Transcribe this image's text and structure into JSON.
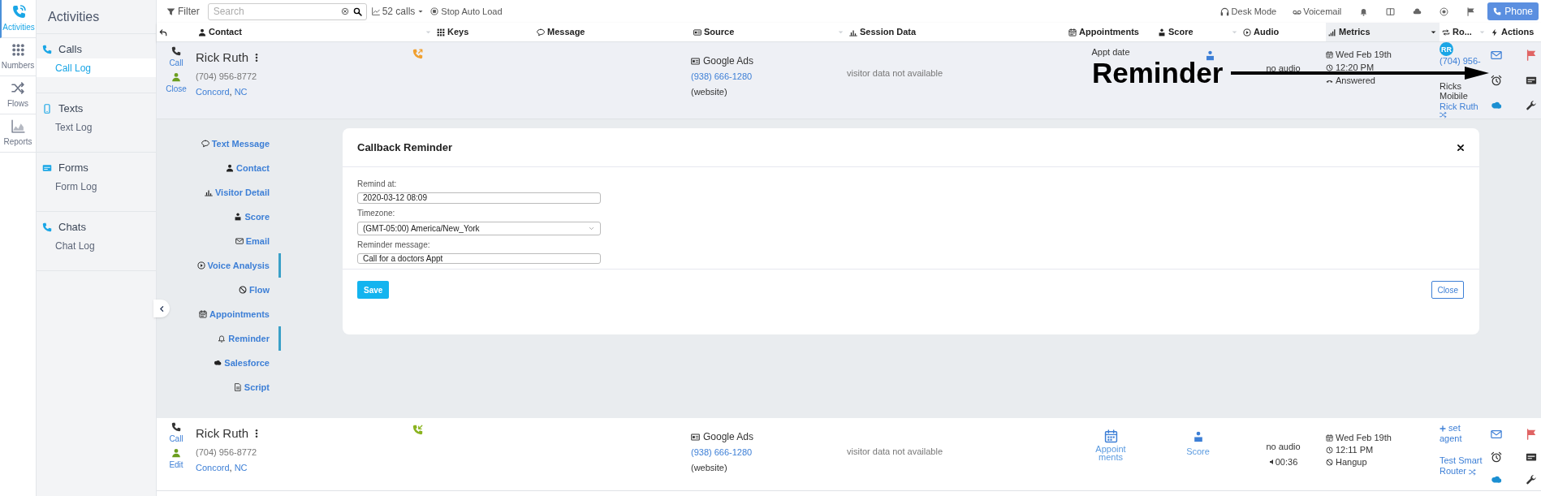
{
  "rail": [
    {
      "label": "Activities",
      "kind": "calls",
      "selected": true
    },
    {
      "label": "Numbers",
      "kind": "numbers",
      "selected": false
    },
    {
      "label": "Flows",
      "kind": "flows",
      "selected": false
    },
    {
      "label": "Reports",
      "kind": "reports",
      "selected": false
    }
  ],
  "panel": {
    "title": "Activities",
    "groups": [
      {
        "label": "Calls",
        "kind": "phone",
        "items": [
          {
            "label": "Call Log",
            "selected": true
          }
        ]
      },
      {
        "label": "Texts",
        "kind": "mobile",
        "items": [
          {
            "label": "Text Log",
            "selected": false
          }
        ]
      },
      {
        "label": "Forms",
        "kind": "card",
        "items": [
          {
            "label": "Form Log",
            "selected": false
          }
        ]
      },
      {
        "label": "Chats",
        "kind": "phone",
        "items": [
          {
            "label": "Chat Log",
            "selected": false
          }
        ]
      }
    ]
  },
  "toolbar": {
    "filter": "Filter",
    "search_placeholder": "Search",
    "count": "52 calls",
    "auto_load": "Stop Auto Load",
    "desk_mode": "Desk Mode",
    "voicemail": "Voicemail",
    "phone_button": "Phone"
  },
  "columns": [
    {
      "kind": "back",
      "sorted": false
    },
    {
      "label": "Contact",
      "kind": "contact",
      "dropdown": true,
      "sorted": false
    },
    {
      "label": "Keys",
      "kind": "keys",
      "sorted": false
    },
    {
      "label": "Message",
      "kind": "message",
      "sorted": false
    },
    {
      "label": "Source",
      "kind": "source",
      "dropdown": true,
      "sorted": false
    },
    {
      "label": "Session Data",
      "kind": "session",
      "sorted": false
    },
    {
      "label": "Appointments",
      "kind": "appointments",
      "sorted": false
    },
    {
      "label": "Score",
      "kind": "score",
      "dropdown": true,
      "sorted": false
    },
    {
      "label": "Audio",
      "kind": "audio",
      "sorted": false
    },
    {
      "label": "Metrics",
      "kind": "metrics",
      "dropdown": true,
      "sorted": true
    },
    {
      "label": "Ro...",
      "kind": "routing",
      "dropdown": true,
      "sorted": false
    },
    {
      "label": "Actions",
      "kind": "actions",
      "sorted": false
    }
  ],
  "rows": [
    {
      "expanded": true,
      "links": [
        {
          "label": "Call",
          "kind": "call"
        },
        {
          "label": "Close",
          "kind": "contact"
        }
      ],
      "name": "Rick Ruth",
      "phone": "(704) 956-8772",
      "location": {
        "city": "Concord",
        "separator": ",",
        "state": "NC"
      },
      "direction": {
        "kind": "outbound"
      },
      "source": {
        "name": "Google Ads",
        "number": "(938) 666-1280",
        "medium": "(website)"
      },
      "session": "visitor data not available",
      "appointments": {
        "kind": "text",
        "label": "Appt date"
      },
      "score": {
        "kind": "icon"
      },
      "audio": {
        "status": "no audio"
      },
      "metrics": {
        "date": "Wed Feb 19th",
        "time": "12:20 PM",
        "outcome": {
          "label": "Answered",
          "kind": "answered"
        }
      },
      "routing": {
        "kind": "agent",
        "avatar": "RR",
        "phone": "(704) 956-",
        "name": "Ricks Moibile",
        "router": "Rick Ruth"
      }
    },
    {
      "expanded": false,
      "links": [
        {
          "label": "Call",
          "kind": "call"
        },
        {
          "label": "Edit",
          "kind": "contact"
        }
      ],
      "name": "Rick Ruth",
      "phone": "(704) 956-8772",
      "location": {
        "city": "Concord",
        "separator": ",",
        "state": "NC"
      },
      "direction": {
        "kind": "inbound"
      },
      "source": {
        "name": "Google Ads",
        "number": "(938) 666-1280",
        "medium": "(website)"
      },
      "session": "visitor data not available",
      "appointments": {
        "kind": "link",
        "label": "Appointments"
      },
      "score": {
        "kind": "link",
        "label": "Score"
      },
      "audio": {
        "status": "no audio",
        "duration": "00:36"
      },
      "metrics": {
        "date": "Wed Feb 19th",
        "time": "12:11 PM",
        "outcome": {
          "label": "Hangup",
          "kind": "hangup"
        }
      },
      "routing": {
        "kind": "unassigned",
        "agent": "set agent",
        "router": "Test Smart Router"
      }
    }
  ],
  "detail": {
    "nav": [
      {
        "label": "Text Message",
        "kind": "chat",
        "highlighted": false
      },
      {
        "label": "Contact",
        "kind": "user",
        "highlighted": false
      },
      {
        "label": "Visitor Detail",
        "kind": "bars",
        "highlighted": false
      },
      {
        "label": "Score",
        "kind": "person",
        "highlighted": false
      },
      {
        "label": "Email",
        "kind": "envelope",
        "highlighted": false
      },
      {
        "label": "Voice Analysis",
        "kind": "play",
        "highlighted": true
      },
      {
        "label": "Flow",
        "kind": "ban",
        "highlighted": false
      },
      {
        "label": "Appointments",
        "kind": "calendar",
        "highlighted": false
      },
      {
        "label": "Reminder",
        "kind": "bell",
        "highlighted": true
      },
      {
        "label": "Salesforce",
        "kind": "sfcloud",
        "highlighted": false
      },
      {
        "label": "Script",
        "kind": "file",
        "highlighted": false
      }
    ],
    "modal": {
      "title": "Callback Reminder",
      "fields": [
        {
          "label": "Remind at:",
          "value": "2020-03-12 08:09",
          "kind": "text"
        },
        {
          "label": "Timezone:",
          "value": "(GMT-05:00) America/New_York",
          "kind": "select"
        },
        {
          "label": "Reminder message:",
          "value": "Call for a doctors Appt",
          "kind": "text"
        }
      ],
      "save": "Save",
      "close": "Close"
    }
  },
  "annotation": {
    "text": "Reminder"
  }
}
